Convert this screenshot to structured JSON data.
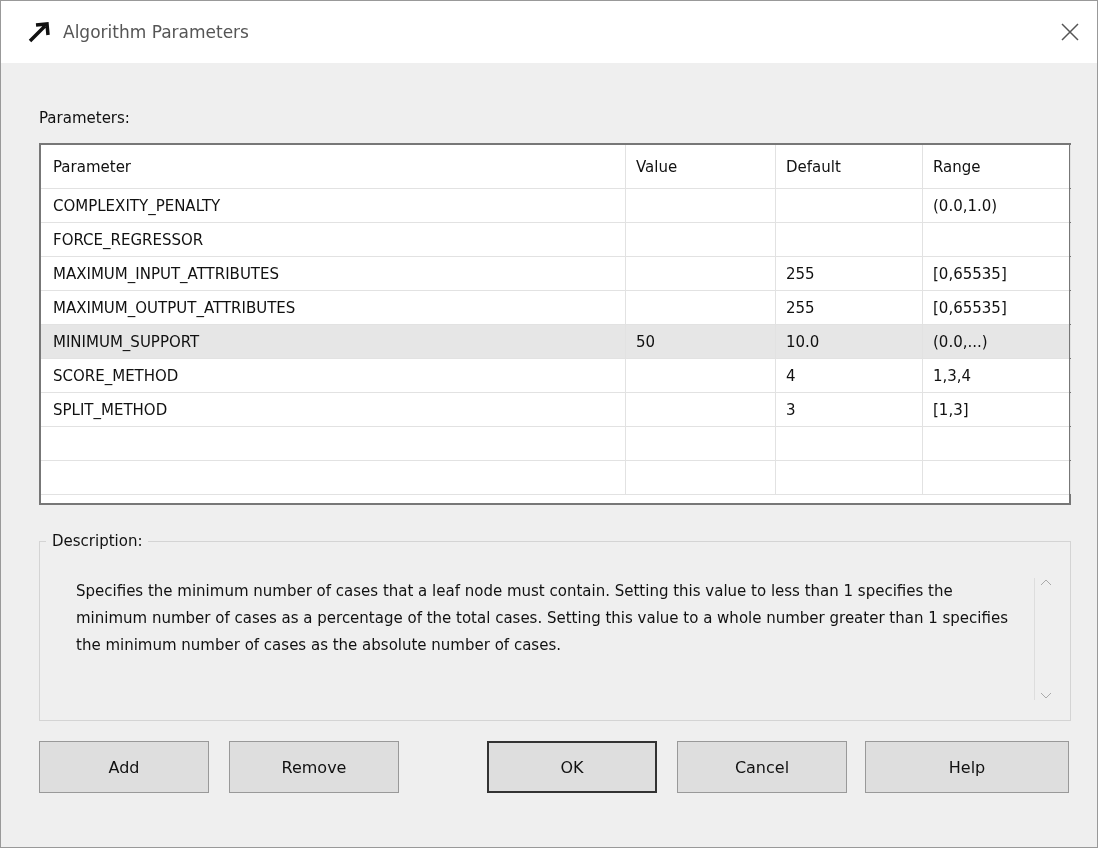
{
  "window": {
    "title": "Algorithm Parameters"
  },
  "parameters_label": "Parameters:",
  "table": {
    "columns": [
      "Parameter",
      "Value",
      "Default",
      "Range"
    ],
    "rows": [
      {
        "cells": [
          "COMPLEXITY_PENALTY",
          "",
          "",
          "(0.0,1.0)"
        ],
        "selected": false
      },
      {
        "cells": [
          "FORCE_REGRESSOR",
          "",
          "",
          ""
        ],
        "selected": false
      },
      {
        "cells": [
          "MAXIMUM_INPUT_ATTRIBUTES",
          "",
          "255",
          "[0,65535]"
        ],
        "selected": false
      },
      {
        "cells": [
          "MAXIMUM_OUTPUT_ATTRIBUTES",
          "",
          "255",
          "[0,65535]"
        ],
        "selected": false
      },
      {
        "cells": [
          "MINIMUM_SUPPORT",
          "50",
          "10.0",
          "(0.0,...)"
        ],
        "selected": true
      },
      {
        "cells": [
          "SCORE_METHOD",
          "",
          "4",
          "1,3,4"
        ],
        "selected": false
      },
      {
        "cells": [
          "SPLIT_METHOD",
          "",
          "3",
          "[1,3]"
        ],
        "selected": false
      }
    ]
  },
  "description": {
    "label": "Description:",
    "text": "Specifies the minimum number of cases that a leaf node must contain. Setting this value to less than 1 specifies the minimum number of cases as a percentage of the total cases. Setting this value to a whole number greater than 1 specifies the minimum number of cases as the absolute number of cases."
  },
  "buttons": [
    {
      "label": "Add",
      "default": false
    },
    {
      "label": "Remove",
      "default": false
    },
    {
      "label": "OK",
      "default": true
    },
    {
      "label": "Cancel",
      "default": false
    },
    {
      "label": "Help",
      "default": false
    }
  ]
}
